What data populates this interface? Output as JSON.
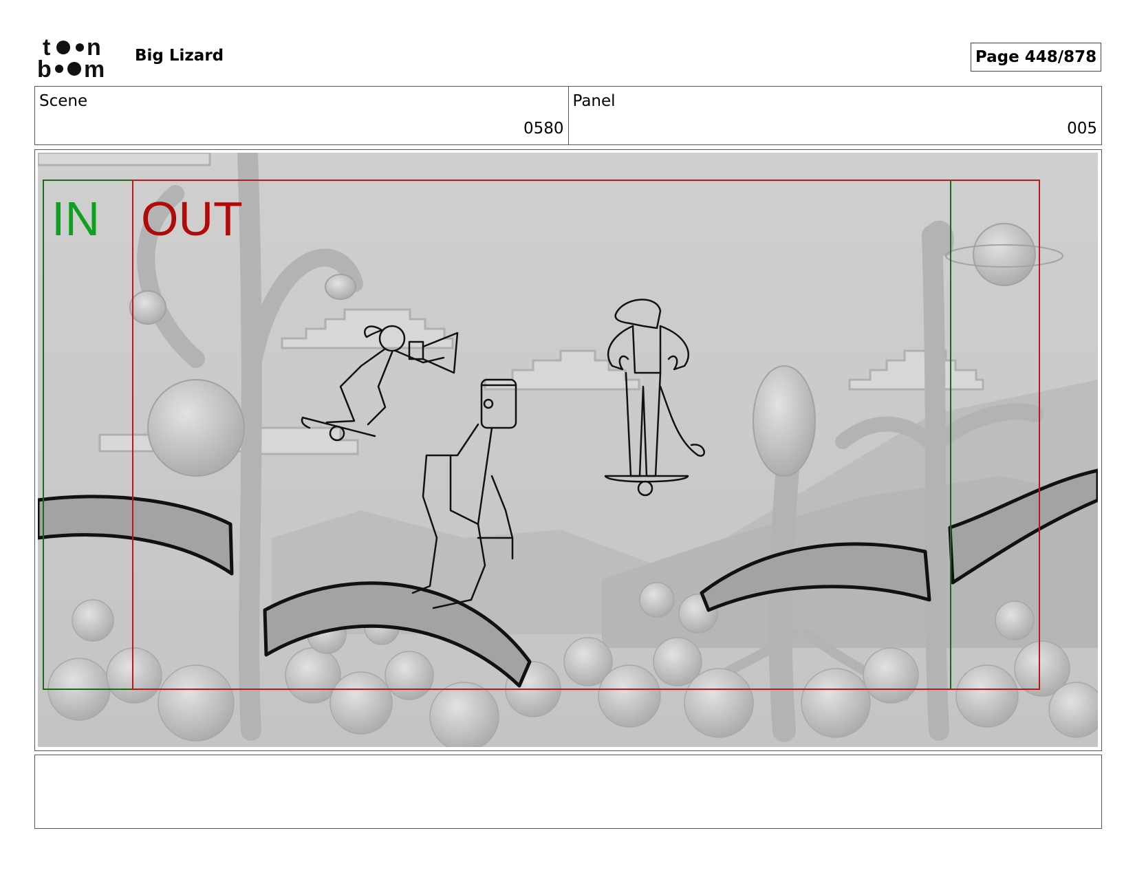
{
  "header": {
    "logo_text": "toon boom",
    "project_title": "Big Lizard",
    "page_label": "Page 448/878"
  },
  "info": {
    "scene_label": "Scene",
    "scene_value": "0580",
    "panel_label": "Panel",
    "panel_value": "005"
  },
  "frame": {
    "in_label": "IN",
    "out_label": "OUT",
    "colors": {
      "in": "#10a020",
      "out": "#b00a0a",
      "in_line": "#1a6a1a",
      "out_line": "#b81818"
    }
  },
  "notes": {
    "text": ""
  }
}
